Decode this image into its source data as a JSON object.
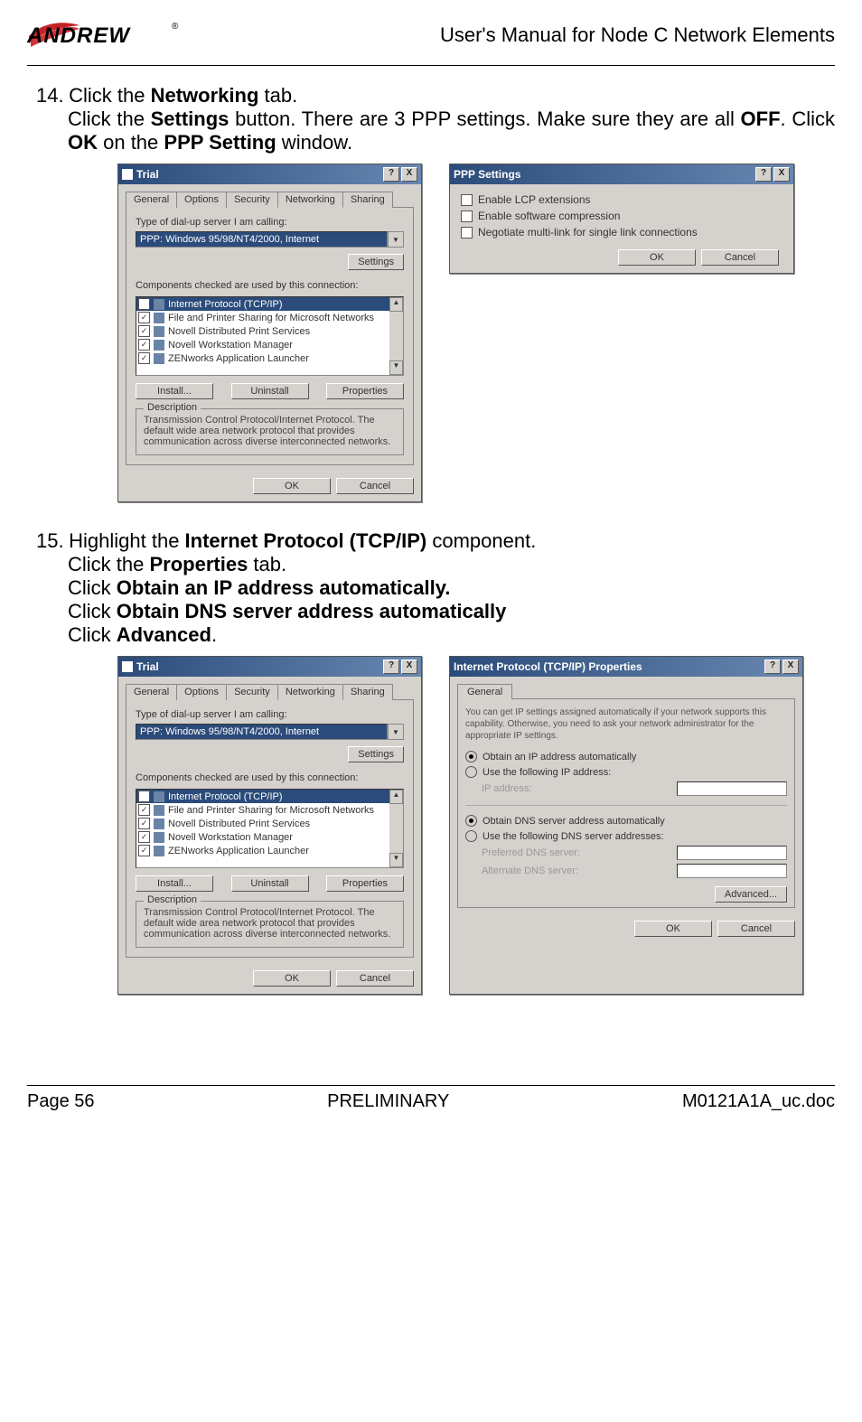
{
  "header": {
    "logo_text": "ANDREW",
    "doc_title": "User's Manual for Node C Network Elements"
  },
  "step14": {
    "num": "14.",
    "line1_pre": "Click the ",
    "line1_bold": "Networking",
    "line1_post": " tab.",
    "line2_a": "Click the ",
    "line2_b": "Settings",
    "line2_c": " button. There are 3 PPP settings. Make sure they are all ",
    "line2_d": "OFF",
    "line2_e": ". Click ",
    "line2_f": "OK",
    "line2_g": " on the ",
    "line2_h": "PPP Setting",
    "line2_i": " window."
  },
  "step15": {
    "num": "15.",
    "l1_a": "Highlight the ",
    "l1_b": "Internet Protocol (TCP/IP)",
    "l1_c": " component.",
    "l2_a": "Click the ",
    "l2_b": "Properties",
    "l2_c": " tab.",
    "l3_a": "Click ",
    "l3_b": "Obtain an IP address automatically.",
    "l4_a": "Click ",
    "l4_b": "Obtain DNS server address automatically",
    "l5_a": "Click ",
    "l5_b": "Advanced",
    "l5_c": "."
  },
  "trial_dialog": {
    "title": "Trial",
    "help": "?",
    "close": "X",
    "tabs": [
      "General",
      "Options",
      "Security",
      "Networking",
      "Sharing"
    ],
    "active_tab_index": 3,
    "server_label": "Type of dial-up server I am calling:",
    "server_value": "PPP: Windows 95/98/NT4/2000, Internet",
    "settings_btn": "Settings",
    "components_label": "Components checked are used by this connection:",
    "components": [
      "Internet Protocol (TCP/IP)",
      "File and Printer Sharing for Microsoft Networks",
      "Novell Distributed Print Services",
      "Novell Workstation Manager",
      "ZENworks Application Launcher"
    ],
    "install_btn": "Install...",
    "uninstall_btn": "Uninstall",
    "properties_btn": "Properties",
    "desc_legend": "Description",
    "desc_text": "Transmission Control Protocol/Internet Protocol. The default wide area network protocol that provides communication across diverse interconnected networks.",
    "ok_btn": "OK",
    "cancel_btn": "Cancel"
  },
  "ppp_dialog": {
    "title": "PPP Settings",
    "help": "?",
    "close": "X",
    "opts": [
      "Enable LCP extensions",
      "Enable software compression",
      "Negotiate multi-link for single link connections"
    ],
    "ok_btn": "OK",
    "cancel_btn": "Cancel"
  },
  "tcpip_dialog": {
    "title": "Internet Protocol (TCP/IP) Properties",
    "help": "?",
    "close": "X",
    "tab": "General",
    "notice": "You can get IP settings assigned automatically if your network supports this capability. Otherwise, you need to ask your network administrator for the appropriate IP settings.",
    "r1": "Obtain an IP address automatically",
    "r2": "Use the following IP address:",
    "ip_lbl": "IP address:",
    "r3": "Obtain DNS server address automatically",
    "r4": "Use the following DNS server addresses:",
    "dns1_lbl": "Preferred DNS server:",
    "dns2_lbl": "Alternate DNS server:",
    "adv_btn": "Advanced...",
    "ok_btn": "OK",
    "cancel_btn": "Cancel"
  },
  "footer": {
    "left": "Page 56",
    "mid": "PRELIMINARY",
    "right": "M0121A1A_uc.doc"
  }
}
